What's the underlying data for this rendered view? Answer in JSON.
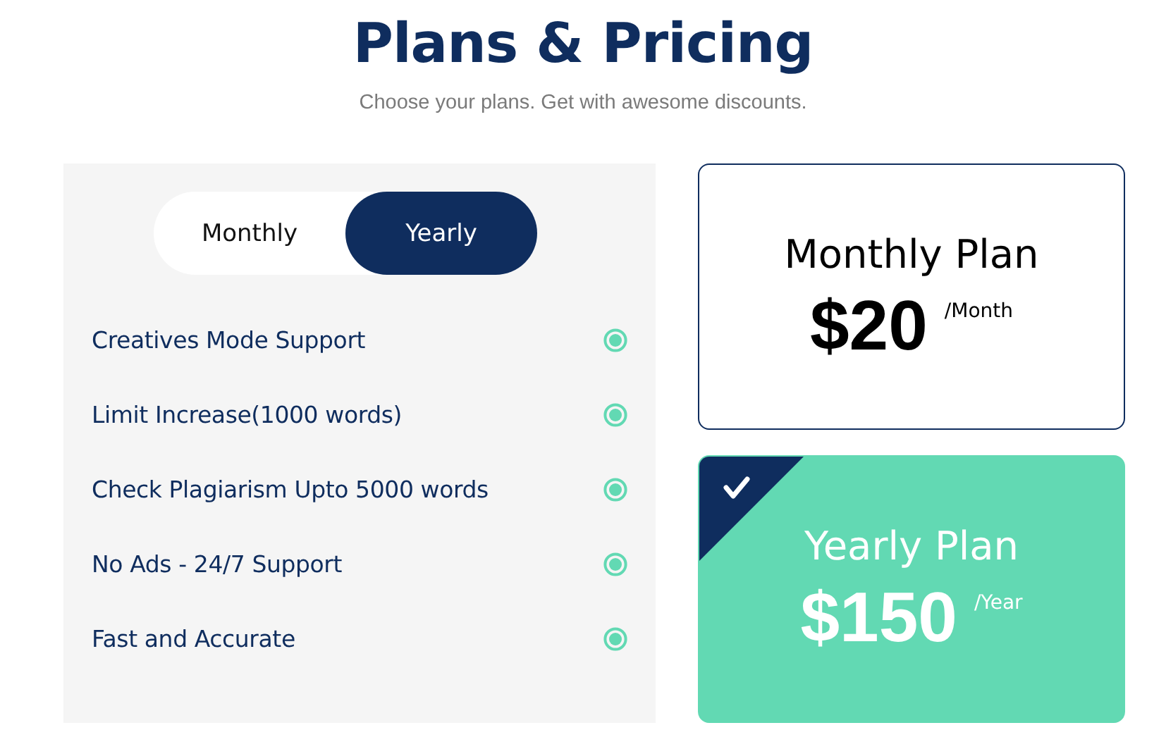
{
  "header": {
    "title": "Plans & Pricing",
    "subtitle": "Choose your plans. Get with awesome discounts."
  },
  "billing_toggle": [
    {
      "label": "Monthly",
      "selected": false
    },
    {
      "label": "Yearly",
      "selected": true
    }
  ],
  "features": [
    {
      "label": "Creatives Mode Support"
    },
    {
      "label": "Limit Increase(1000 words)"
    },
    {
      "label": "Check Plagiarism Upto 5000 words"
    },
    {
      "label": "No Ads - 24/7 Support"
    },
    {
      "label": "Fast and Accurate"
    }
  ],
  "plans": [
    {
      "name": "Monthly Plan",
      "price": "$20",
      "period": "/Month",
      "selected": false
    },
    {
      "name": "Yearly Plan",
      "price": "$150",
      "period": "/Year",
      "selected": true
    }
  ]
}
